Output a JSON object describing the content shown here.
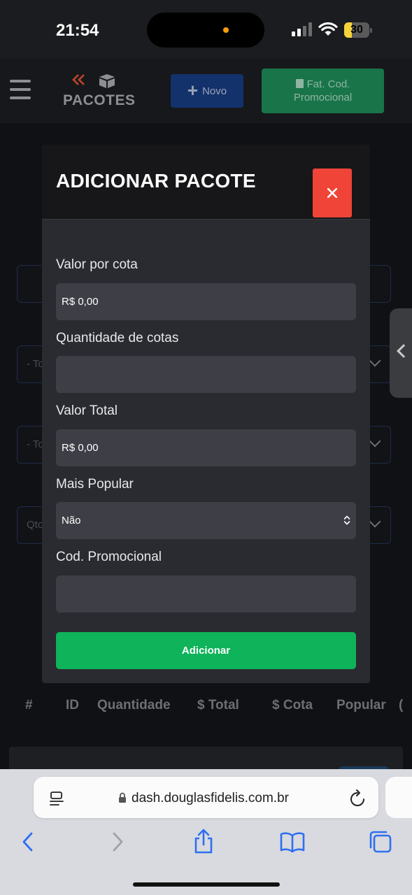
{
  "status_bar": {
    "time": "21:54",
    "battery": "30"
  },
  "header": {
    "title": "PACOTES",
    "new_button": "Novo",
    "promo_button_line1": "Fat. Cod.",
    "promo_button_line2": "Promocional"
  },
  "background": {
    "filter_1": "- To",
    "filter_2": "- To",
    "filter_3": "Qto",
    "table_columns": [
      "#",
      "ID",
      "Quantidade",
      "$ Total",
      "$ Cota",
      "Popular",
      "("
    ]
  },
  "modal": {
    "title": "ADICIONAR PACOTE",
    "fields": [
      {
        "label": "Valor por cota",
        "value": "R$ 0,00"
      },
      {
        "label": "Quantidade de cotas",
        "value": ""
      },
      {
        "label": "Valor Total",
        "value": "R$ 0,00"
      },
      {
        "label": "Mais Popular",
        "value": "Não"
      },
      {
        "label": "Cod. Promocional",
        "value": ""
      }
    ],
    "submit_label": "Adicionar"
  },
  "browser": {
    "url": "dash.douglasfidelis.com.br"
  },
  "colors": {
    "accent_green": "#0fb35a",
    "close_red": "#f04438",
    "novo_blue": "#13326c"
  }
}
